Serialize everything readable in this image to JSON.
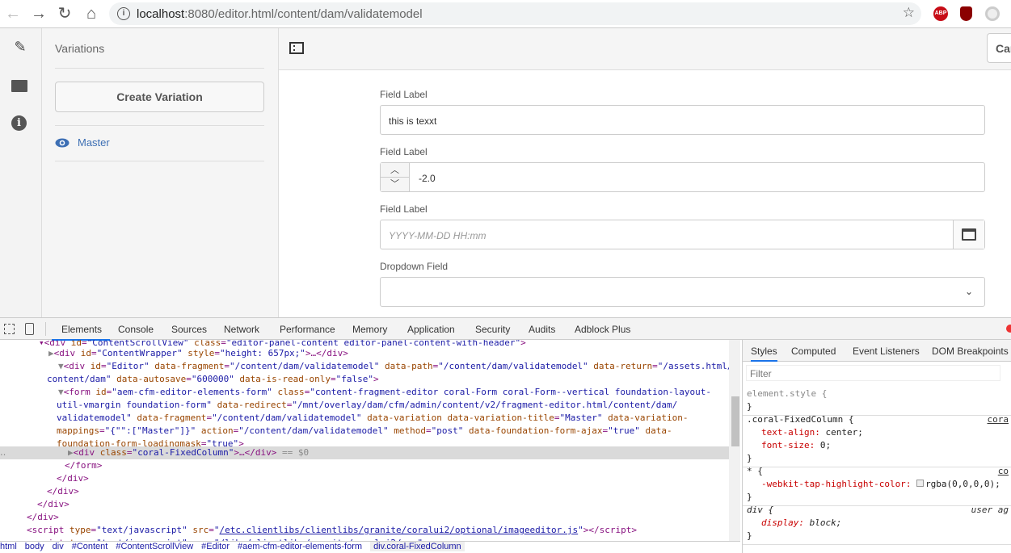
{
  "browser": {
    "url_host": "localhost",
    "url_path": ":8080/editor.html/content/dam/validatemodel",
    "icons": [
      "back-icon",
      "forward-icon",
      "reload-icon",
      "home-icon",
      "info-icon",
      "star-icon",
      "abp-icon",
      "shield-icon",
      "extension-icon"
    ]
  },
  "variations": {
    "title": "Variations",
    "create_label": "Create Variation",
    "items": [
      {
        "label": "Master"
      }
    ]
  },
  "header": {
    "cancel_label": "Cancel"
  },
  "form": {
    "fields": [
      {
        "label": "Field Label",
        "value": "this is texxt"
      },
      {
        "label": "Field Label",
        "value": "-2.0"
      },
      {
        "label": "Field Label",
        "placeholder": "YYYY-MM-DD HH:mm"
      },
      {
        "label": "Dropdown Field",
        "value": ""
      }
    ]
  },
  "devtools": {
    "tabs": [
      "Elements",
      "Console",
      "Sources",
      "Network",
      "Performance",
      "Memory",
      "Application",
      "Security",
      "Audits",
      "Adblock Plus"
    ],
    "active_tab": "Elements",
    "dom_lines": [
      [
        [
          "tg",
          "▾<div "
        ],
        [
          "an",
          "id"
        ],
        [
          "tg",
          "="
        ],
        [
          "av",
          "\"ContentScrollView\""
        ],
        [
          "an",
          " class"
        ],
        [
          "tg",
          "="
        ],
        [
          "av",
          "\"editor-panel-content editor-panel-content-with-header\""
        ],
        [
          "tg",
          ">"
        ]
      ],
      [
        [
          "gr",
          "▶"
        ],
        [
          "tg",
          "<div "
        ],
        [
          "an",
          "id"
        ],
        [
          "tg",
          "="
        ],
        [
          "av",
          "\"ContentWrapper\""
        ],
        [
          "an",
          " style"
        ],
        [
          "tg",
          "="
        ],
        [
          "av",
          "\"height: 657px;\""
        ],
        [
          "tg",
          ">…</div>"
        ]
      ],
      [
        [
          "gr",
          "▼"
        ],
        [
          "tg",
          "<div "
        ],
        [
          "an",
          "id"
        ],
        [
          "tg",
          "="
        ],
        [
          "av",
          "\"Editor\""
        ],
        [
          "an",
          " data-fragment"
        ],
        [
          "tg",
          "="
        ],
        [
          "av",
          "\"/content/dam/validatemodel\""
        ],
        [
          "an",
          " data-path"
        ],
        [
          "tg",
          "="
        ],
        [
          "av",
          "\"/content/dam/validatemodel\""
        ],
        [
          "an",
          " data-return"
        ],
        [
          "tg",
          "="
        ],
        [
          "av",
          "\"/assets.html/"
        ]
      ],
      [
        [
          "av",
          "content/dam\""
        ],
        [
          "an",
          " data-autosave"
        ],
        [
          "tg",
          "="
        ],
        [
          "av",
          "\"600000\""
        ],
        [
          "an",
          " data-is-read-only"
        ],
        [
          "tg",
          "="
        ],
        [
          "av",
          "\"false\""
        ],
        [
          "tg",
          ">"
        ]
      ],
      [
        [
          "gr",
          "▼"
        ],
        [
          "tg",
          "<form "
        ],
        [
          "an",
          "id"
        ],
        [
          "tg",
          "="
        ],
        [
          "av",
          "\"aem-cfm-editor-elements-form\""
        ],
        [
          "an",
          " class"
        ],
        [
          "tg",
          "="
        ],
        [
          "av",
          "\"content-fragment-editor coral-Form coral-Form--vertical foundation-layout-"
        ]
      ],
      [
        [
          "av",
          "util-vmargin foundation-form\""
        ],
        [
          "an",
          " data-redirect"
        ],
        [
          "tg",
          "="
        ],
        [
          "av",
          "\"/mnt/overlay/dam/cfm/admin/content/v2/fragment-editor.html/content/dam/"
        ]
      ],
      [
        [
          "av",
          "validatemodel\""
        ],
        [
          "an",
          " data-fragment"
        ],
        [
          "tg",
          "="
        ],
        [
          "av",
          "\"/content/dam/validatemodel\""
        ],
        [
          "an",
          " data-variation data-variation-title"
        ],
        [
          "tg",
          "="
        ],
        [
          "av",
          "\"Master\""
        ],
        [
          "an",
          " data-variation-"
        ]
      ],
      [
        [
          "an",
          "mappings"
        ],
        [
          "tg",
          "="
        ],
        [
          "av",
          "\"{\"\":[\"Master\"]}\""
        ],
        [
          "an",
          " action"
        ],
        [
          "tg",
          "="
        ],
        [
          "av",
          "\"/content/dam/validatemodel\""
        ],
        [
          "an",
          " method"
        ],
        [
          "tg",
          "="
        ],
        [
          "av",
          "\"post\""
        ],
        [
          "an",
          " data-foundation-form-ajax"
        ],
        [
          "tg",
          "="
        ],
        [
          "av",
          "\"true\""
        ],
        [
          "an",
          " data-"
        ]
      ],
      [
        [
          "an",
          "foundation-form-loadingmask"
        ],
        [
          "tg",
          "="
        ],
        [
          "av",
          "\"true\""
        ],
        [
          "tg",
          ">"
        ]
      ],
      [
        [
          "gr",
          "▶"
        ],
        [
          "tg",
          "<div "
        ],
        [
          "an",
          "class"
        ],
        [
          "tg",
          "="
        ],
        [
          "av",
          "\"coral-FixedColumn\""
        ],
        [
          "tg",
          ">…</div>"
        ],
        [
          "gr",
          " == $0"
        ]
      ],
      [
        [
          "tg",
          "</form>"
        ]
      ],
      [
        [
          "tg",
          "</div>"
        ]
      ],
      [
        [
          "tg",
          "</div>"
        ]
      ],
      [
        [
          "tg",
          "</div>"
        ]
      ],
      [
        [
          "tg",
          "</div>"
        ]
      ],
      [
        [
          "tg",
          "<script "
        ],
        [
          "an",
          "type"
        ],
        [
          "tg",
          "="
        ],
        [
          "av",
          "\"text/javascript\""
        ],
        [
          "an",
          " src"
        ],
        [
          "tg",
          "="
        ],
        [
          "av",
          "\""
        ],
        [
          "lk",
          "/etc.clientlibs/clientlibs/granite/coralui2/optional/imageeditor.js"
        ],
        [
          "av",
          "\""
        ],
        [
          "tg",
          "></script>"
        ]
      ],
      [
        [
          "tg",
          "<script "
        ],
        [
          "an",
          "type"
        ],
        [
          "tg",
          "="
        ],
        [
          "av",
          "\"text/javascript\""
        ],
        [
          "an",
          " src"
        ],
        [
          "tg",
          "="
        ],
        [
          "av",
          "\"/libs/clientlibs/granite/coralui2/...\""
        ]
      ]
    ],
    "selected_line": 9,
    "breadcrumbs": [
      "html",
      "body",
      "div",
      "#Content",
      "#ContentScrollView",
      "#Editor",
      "#aem-cfm-editor-elements-form",
      "div.coral-FixedColumn"
    ],
    "styles": {
      "tabs": [
        "Styles",
        "Computed",
        "Event Listeners",
        "DOM Breakpoints"
      ],
      "filter_placeholder": "Filter",
      "rules": [
        {
          "selector": "element.style {",
          "props": [],
          "source": ""
        },
        {
          "selector": ".coral-FixedColumn {",
          "props": [
            [
              "text-align",
              "center"
            ],
            [
              "font-size",
              "0"
            ]
          ],
          "source": "cora"
        },
        {
          "selector": "* {",
          "props": [
            [
              "-webkit-tap-highlight-color",
              "rgba(0,0,0,0)"
            ]
          ],
          "source": "co"
        },
        {
          "selector": "div {",
          "props": [
            [
              "display",
              "block"
            ]
          ],
          "source": "user ag"
        }
      ]
    }
  }
}
